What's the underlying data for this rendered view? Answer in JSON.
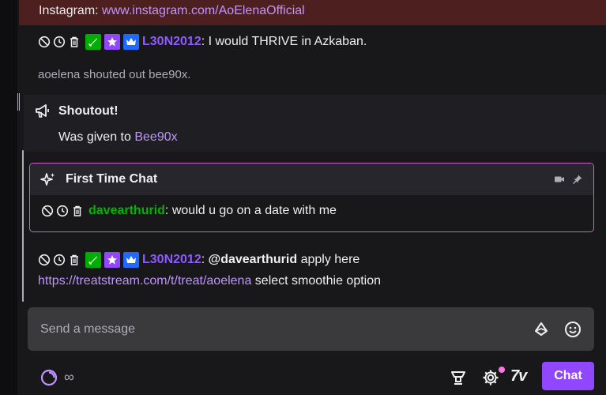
{
  "pinned": {
    "prefix": "Instagram: ",
    "link": "www.instagram.com/AoElenaOfficial"
  },
  "messages": [
    {
      "user": "L30N2012",
      "text": ": I would THRIVE in Azkaban."
    }
  ],
  "system_notice": "aoelena shouted out bee90x.",
  "shoutout": {
    "title": "Shoutout!",
    "body_prefix": "Was given to ",
    "body_link": "Bee90x"
  },
  "first_time_chat": {
    "title": "First Time Chat",
    "user": "davearthurid",
    "text": ": would u go on a date with me"
  },
  "reply_message": {
    "user": "L30N2012",
    "separator": ": ",
    "mention": "@davearthurid",
    "text": " apply here",
    "link": "https://treatstream.com/t/treat/aoelena",
    "text2": " select smoothie option"
  },
  "input": {
    "placeholder": "Send a message"
  },
  "bottom_bar": {
    "infinity": "∞",
    "seven_tv": "7v",
    "chat_button": "Chat"
  },
  "icons": {
    "mod_actions": [
      "ban-icon",
      "timeout-icon",
      "delete-icon"
    ],
    "badges": [
      "moderator-badge",
      "vip-badge",
      "subscriber-badge"
    ]
  },
  "colors": {
    "accent": "#9147ff",
    "username_purple": "#8e5bff",
    "username_green": "#00b500",
    "link": "#bf94ff",
    "first_time_border": "#d05ed6",
    "pinned_bg": "#4d1f1f"
  }
}
